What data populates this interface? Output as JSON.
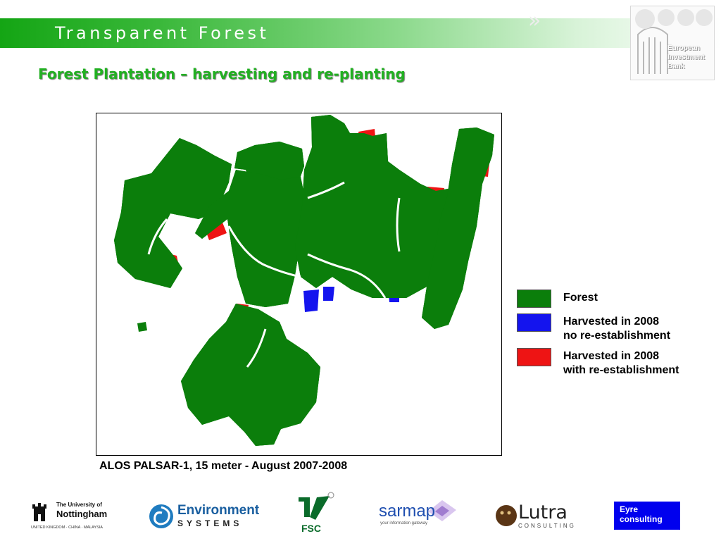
{
  "header": {
    "title": "Transparent  Forest"
  },
  "eib_logo": {
    "lines": [
      "European",
      "Investment",
      "Bank"
    ]
  },
  "slide": {
    "title": "Forest Plantation  –  harvesting and re-planting"
  },
  "map": {
    "caption": "ALOS PALSAR-1, 15 meter  -  August 2007-2008",
    "colors": {
      "forest": "#0b7e0b",
      "harvested_no_reestablishment": "#1414ee",
      "harvested_with_reestablishment": "#ee1414"
    }
  },
  "legend": [
    {
      "color": "#0b7e0b",
      "line1": "Forest",
      "line2": ""
    },
    {
      "color": "#1414ee",
      "line1": "Harvested in 2008",
      "line2": "no re-establishment"
    },
    {
      "color": "#ee1414",
      "line1": "Harvested  in 2008",
      "line2": "with re-establishment"
    }
  ],
  "logos": {
    "nottingham": {
      "name_line1": "The University of",
      "name_line2": "Nottingham",
      "tagline": "UNITED KINGDOM · CHINA · MALAYSIA"
    },
    "environment_systems": {
      "line1": "Environment",
      "line2": "SYSTEMS"
    },
    "fsc": {
      "text": "FSC"
    },
    "sarmap": {
      "name": "sarmap",
      "tagline": "your information gateway"
    },
    "lutra": {
      "name": "Lutra",
      "tagline": "CONSULTING"
    },
    "eyre": {
      "line1": "Eyre",
      "line2": "consulting"
    }
  }
}
